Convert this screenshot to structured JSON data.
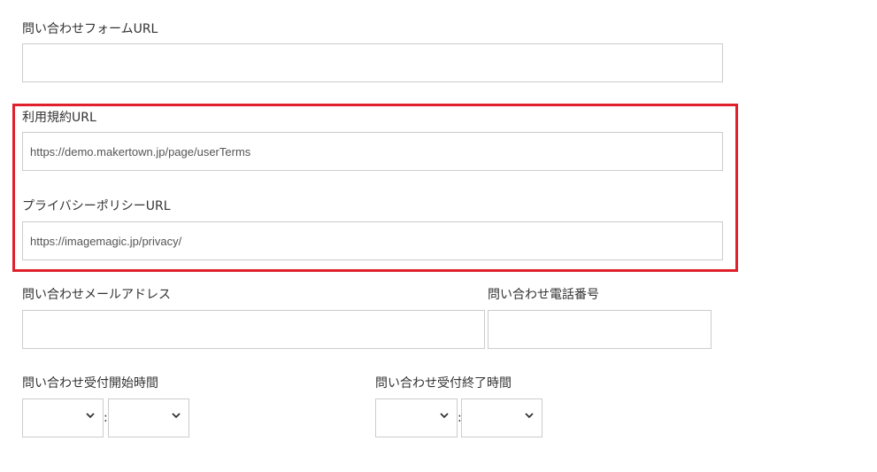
{
  "contact_form_url": {
    "label": "問い合わせフォームURL",
    "value": ""
  },
  "terms_url": {
    "label": "利用規約URL",
    "value": "https://demo.makertown.jp/page/userTerms"
  },
  "privacy_url": {
    "label": "プライバシーポリシーURL",
    "value": "https://imagemagic.jp/privacy/"
  },
  "contact_email": {
    "label": "問い合わせメールアドレス",
    "value": ""
  },
  "contact_phone": {
    "label": "問い合わせ電話番号",
    "value": ""
  },
  "start_time": {
    "label": "問い合わせ受付開始時間",
    "separator": ":",
    "hour": "",
    "minute": ""
  },
  "end_time": {
    "label": "問い合わせ受付終了時間",
    "separator": ":",
    "hour": "",
    "minute": ""
  },
  "highlight": {
    "color": "#e0202c"
  },
  "icons": {
    "dropdown": "chevron-down-icon"
  }
}
